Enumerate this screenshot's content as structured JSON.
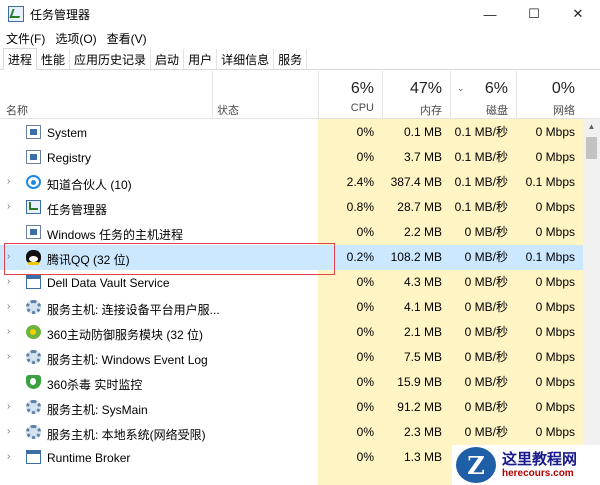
{
  "window": {
    "title": "任务管理器",
    "controls": {
      "minimize": "—",
      "maximize": "☐",
      "close": "✕"
    }
  },
  "menu": [
    "文件(F)",
    "选项(O)",
    "查看(V)"
  ],
  "tabs": [
    "进程",
    "性能",
    "应用历史记录",
    "启动",
    "用户",
    "详细信息",
    "服务"
  ],
  "columns": {
    "name": "名称",
    "status": "状态",
    "cpu": {
      "pct": "6%",
      "label": "CPU"
    },
    "memory": {
      "pct": "47%",
      "label": "内存"
    },
    "disk": {
      "pct": "6%",
      "label": "磁盘"
    },
    "network": {
      "pct": "0%",
      "label": "网络"
    }
  },
  "processes": [
    {
      "name": "System",
      "icon": "system-icon",
      "expandable": false,
      "cpu": "0%",
      "mem": "0.1 MB",
      "disk": "0.1 MB/秒",
      "net": "0 Mbps"
    },
    {
      "name": "Registry",
      "icon": "system-icon",
      "expandable": false,
      "cpu": "0%",
      "mem": "3.7 MB",
      "disk": "0.1 MB/秒",
      "net": "0 Mbps"
    },
    {
      "name": "知道合伙人 (10)",
      "icon": "app-circle-icon",
      "expandable": true,
      "cpu": "2.4%",
      "mem": "387.4 MB",
      "disk": "0.1 MB/秒",
      "net": "0.1 Mbps"
    },
    {
      "name": "任务管理器",
      "icon": "task-manager-icon",
      "expandable": true,
      "cpu": "0.8%",
      "mem": "28.7 MB",
      "disk": "0.1 MB/秒",
      "net": "0 Mbps"
    },
    {
      "name": "Windows 任务的主机进程",
      "icon": "system-icon",
      "expandable": false,
      "cpu": "0%",
      "mem": "2.2 MB",
      "disk": "0 MB/秒",
      "net": "0 Mbps"
    },
    {
      "name": "腾讯QQ (32 位)",
      "icon": "qq-icon",
      "expandable": true,
      "cpu": "0.2%",
      "mem": "108.2 MB",
      "disk": "0 MB/秒",
      "net": "0.1 Mbps",
      "selected": true
    },
    {
      "name": "Dell Data Vault Service",
      "icon": "window-icon",
      "expandable": true,
      "cpu": "0%",
      "mem": "4.3 MB",
      "disk": "0 MB/秒",
      "net": "0 Mbps"
    },
    {
      "name": "服务主机: 连接设备平台用户服...",
      "icon": "gear-icon",
      "expandable": true,
      "cpu": "0%",
      "mem": "4.1 MB",
      "disk": "0 MB/秒",
      "net": "0 Mbps"
    },
    {
      "name": "360主动防御服务模块 (32 位)",
      "icon": "360-icon",
      "expandable": true,
      "cpu": "0%",
      "mem": "2.1 MB",
      "disk": "0 MB/秒",
      "net": "0 Mbps"
    },
    {
      "name": "服务主机: Windows Event Log",
      "icon": "gear-icon",
      "expandable": true,
      "cpu": "0%",
      "mem": "7.5 MB",
      "disk": "0 MB/秒",
      "net": "0 Mbps"
    },
    {
      "name": "360杀毒 实时监控",
      "icon": "shield-icon",
      "expandable": false,
      "cpu": "0%",
      "mem": "15.9 MB",
      "disk": "0 MB/秒",
      "net": "0 Mbps"
    },
    {
      "name": "服务主机: SysMain",
      "icon": "gear-icon",
      "expandable": true,
      "cpu": "0%",
      "mem": "91.2 MB",
      "disk": "0 MB/秒",
      "net": "0 Mbps"
    },
    {
      "name": "服务主机: 本地系统(网络受限)",
      "icon": "gear-icon",
      "expandable": true,
      "cpu": "0%",
      "mem": "2.3 MB",
      "disk": "0 MB/秒",
      "net": "0 Mbps"
    },
    {
      "name": "Runtime Broker",
      "icon": "window-icon",
      "expandable": true,
      "cpu": "0%",
      "mem": "1.3 MB",
      "disk": "0 MB/秒",
      "net": "0 Mbps"
    }
  ],
  "watermark": {
    "cn": "这里教程网",
    "en": "herecours.com"
  },
  "colors": {
    "resource_highlight": "#fff4c4",
    "selected_row": "#cce8ff",
    "annotation_box": "#e0434b"
  }
}
